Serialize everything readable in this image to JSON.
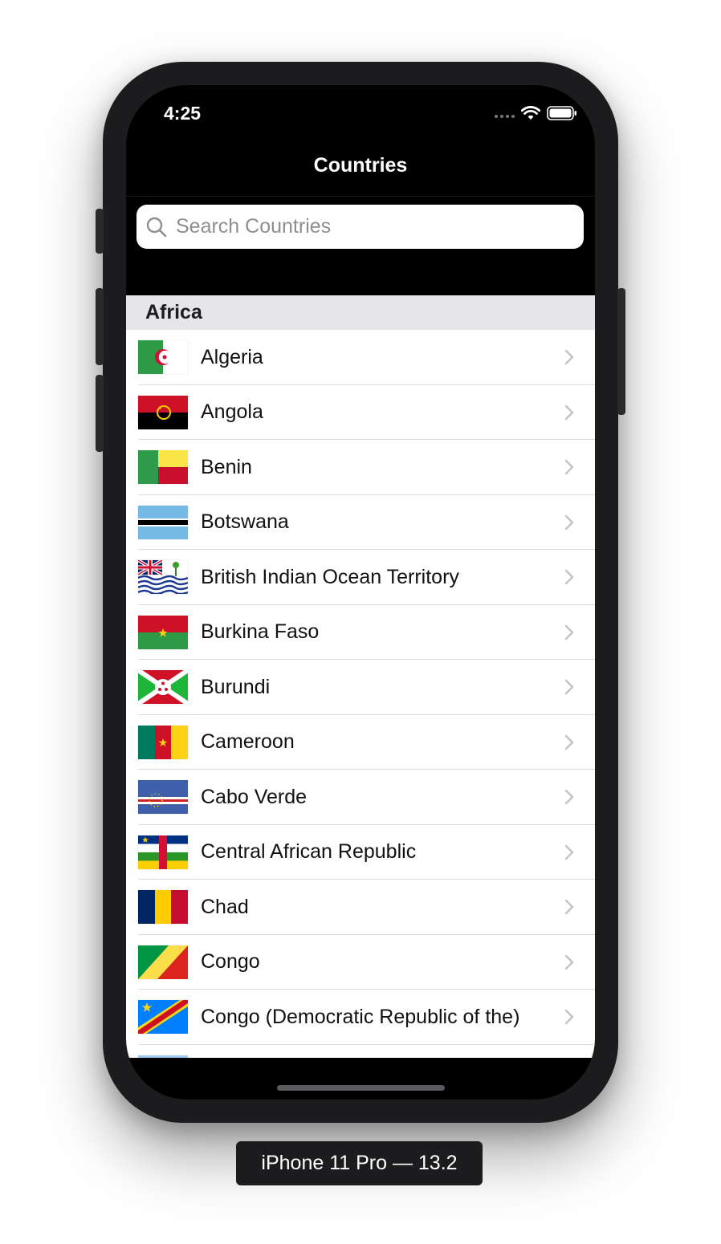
{
  "status": {
    "time": "4:25"
  },
  "nav": {
    "title": "Countries"
  },
  "search": {
    "placeholder": "Search Countries"
  },
  "section": {
    "title": "Africa"
  },
  "countries": [
    {
      "name": "Algeria"
    },
    {
      "name": "Angola"
    },
    {
      "name": "Benin"
    },
    {
      "name": "Botswana"
    },
    {
      "name": "British Indian Ocean Territory"
    },
    {
      "name": "Burkina Faso"
    },
    {
      "name": "Burundi"
    },
    {
      "name": "Cameroon"
    },
    {
      "name": "Cabo Verde"
    },
    {
      "name": "Central African Republic"
    },
    {
      "name": "Chad"
    },
    {
      "name": "Congo"
    },
    {
      "name": "Congo (Democratic Republic of the)"
    }
  ],
  "device": {
    "label": "iPhone 11 Pro — 13.2"
  },
  "colors": {
    "section_bg": "#e5e5ea",
    "chevron": "#c4c4c7",
    "nav_bg": "#000000"
  }
}
